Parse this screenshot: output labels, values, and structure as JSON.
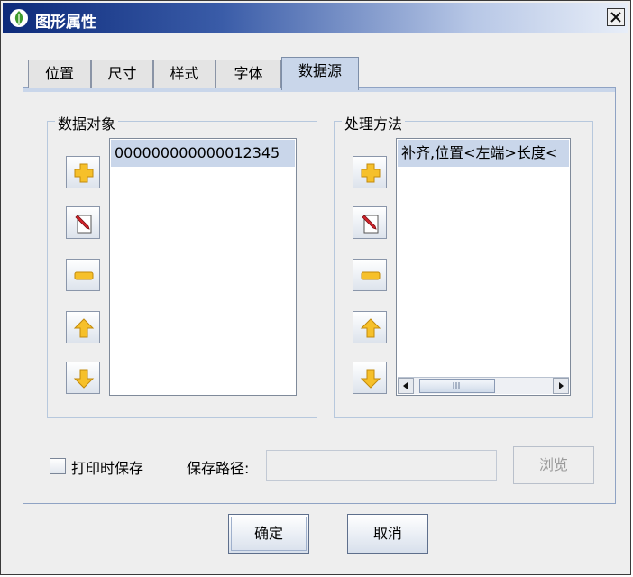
{
  "window": {
    "title": "图形属性"
  },
  "tabs": [
    {
      "label": "位置"
    },
    {
      "label": "尺寸"
    },
    {
      "label": "样式"
    },
    {
      "label": "字体"
    },
    {
      "label": "数据源",
      "active": true
    }
  ],
  "data_objects": {
    "title": "数据对象",
    "items": [
      "000000000000012345"
    ]
  },
  "processing": {
    "title": "处理方法",
    "items": [
      "补齐,位置<左端>长度<"
    ]
  },
  "side_buttons": [
    "plus-icon",
    "edit-icon",
    "minus-icon",
    "arrow-up-icon",
    "arrow-down-icon"
  ],
  "footer": {
    "print_save_label": "打印时保存",
    "print_save_checked": false,
    "save_path_label": "保存路径:",
    "save_path_value": "",
    "browse_label": "浏览",
    "ok_label": "确定",
    "cancel_label": "取消"
  },
  "colors": {
    "title_gradient_start": "#0c2a7a",
    "tab_active": "#c9d6ea",
    "selection": "#c9d6ea",
    "icon_yellow": "#f6c02a"
  }
}
